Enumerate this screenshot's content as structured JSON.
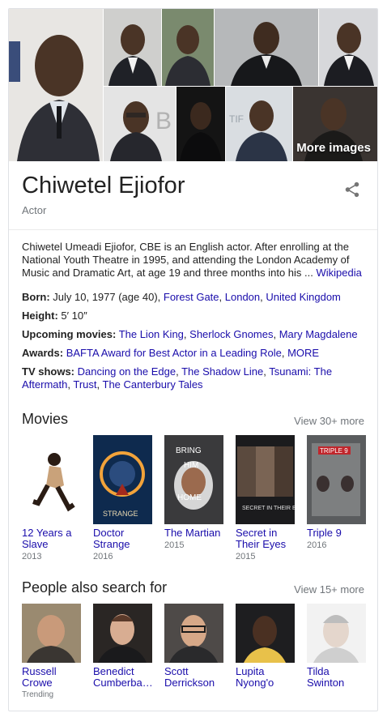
{
  "images": {
    "more_label": "More images"
  },
  "header": {
    "title": "Chiwetel Ejiofor",
    "subtitle": "Actor"
  },
  "description": {
    "text": "Chiwetel Umeadi Ejiofor, CBE is an English actor. After enrolling at the National Youth Theatre in 1995, and attending the London Academy of Music and Dramatic Art, at age 19 and three months into his ... ",
    "source_link": "Wikipedia"
  },
  "facts": {
    "born": {
      "label": "Born:",
      "text": " July 10, 1977 (age 40), ",
      "links": [
        "Forest Gate",
        "London",
        "United Kingdom"
      ]
    },
    "height": {
      "label": "Height:",
      "text": " 5′ 10″"
    },
    "upcoming_movies": {
      "label": "Upcoming movies:",
      "links": [
        "The Lion King",
        "Sherlock Gnomes",
        "Mary Magdalene"
      ]
    },
    "awards": {
      "label": "Awards:",
      "links": [
        "BAFTA Award for Best Actor in a Leading Role",
        "MORE"
      ]
    },
    "tv_shows": {
      "label": "TV shows:",
      "links": [
        "Dancing on the Edge",
        "The Shadow Line",
        "Tsunami: The Aftermath",
        "Trust",
        "The Canterbury Tales"
      ]
    }
  },
  "movies": {
    "title": "Movies",
    "view_more": "View 30+ more",
    "items": [
      {
        "name": "12 Years a Slave",
        "year": "2013"
      },
      {
        "name": "Doctor Strange",
        "year": "2016"
      },
      {
        "name": "The Martian",
        "year": "2015"
      },
      {
        "name": "Secret in Their Eyes",
        "year": "2015"
      },
      {
        "name": "Triple 9",
        "year": "2016"
      }
    ]
  },
  "people": {
    "title": "People also search for",
    "view_more": "View 15+ more",
    "items": [
      {
        "name": "Russell Crowe",
        "sub": "Trending"
      },
      {
        "name": "Benedict Cumberba…",
        "sub": ""
      },
      {
        "name": "Scott Derrickson",
        "sub": ""
      },
      {
        "name": "Lupita Nyong'o",
        "sub": ""
      },
      {
        "name": "Tilda Swinton",
        "sub": ""
      }
    ]
  },
  "colors": {
    "link": "#1a0dab",
    "muted": "#70757a"
  }
}
